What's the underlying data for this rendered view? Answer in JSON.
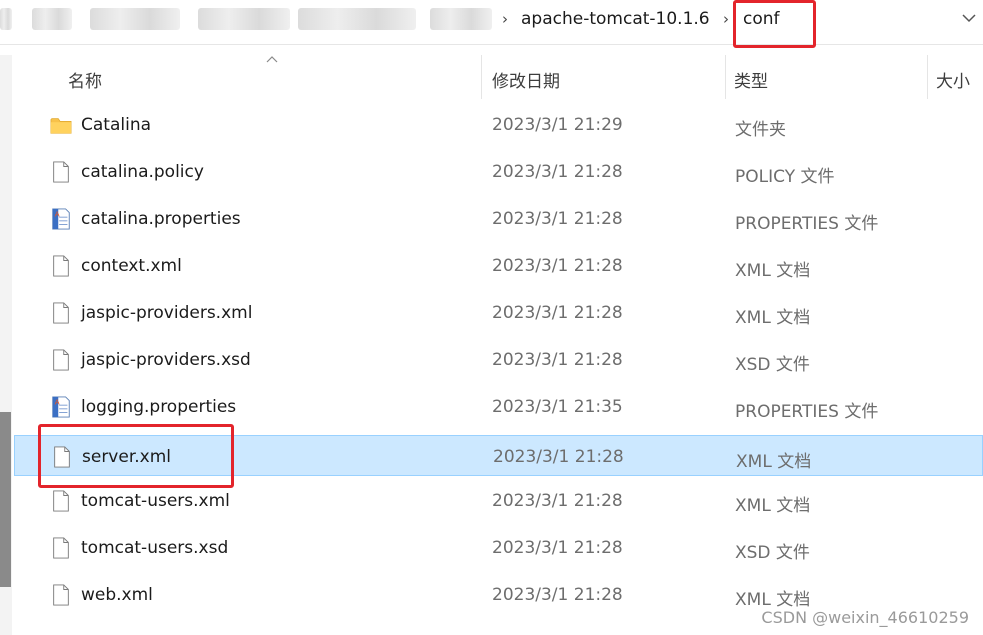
{
  "breadcrumb": {
    "separator": "›",
    "items": [
      "apache-tomcat-10.1.6",
      "conf"
    ]
  },
  "columns": {
    "name": "名称",
    "date": "修改日期",
    "type": "类型",
    "size": "大小"
  },
  "files": [
    {
      "name": "Catalina",
      "date": "2023/3/1 21:29",
      "type": "文件夹",
      "icon": "folder-icon"
    },
    {
      "name": "catalina.policy",
      "date": "2023/3/1 21:28",
      "type": "POLICY 文件",
      "icon": "file-icon"
    },
    {
      "name": "catalina.properties",
      "date": "2023/3/1 21:28",
      "type": "PROPERTIES 文件",
      "icon": "properties-file-icon"
    },
    {
      "name": "context.xml",
      "date": "2023/3/1 21:28",
      "type": "XML 文档",
      "icon": "file-icon"
    },
    {
      "name": "jaspic-providers.xml",
      "date": "2023/3/1 21:28",
      "type": "XML 文档",
      "icon": "file-icon"
    },
    {
      "name": "jaspic-providers.xsd",
      "date": "2023/3/1 21:28",
      "type": "XSD 文件",
      "icon": "file-icon"
    },
    {
      "name": "logging.properties",
      "date": "2023/3/1 21:35",
      "type": "PROPERTIES 文件",
      "icon": "properties-file-icon"
    },
    {
      "name": "server.xml",
      "date": "2023/3/1 21:28",
      "type": "XML 文档",
      "icon": "file-icon",
      "selected": true
    },
    {
      "name": "tomcat-users.xml",
      "date": "2023/3/1 21:28",
      "type": "XML 文档",
      "icon": "file-icon"
    },
    {
      "name": "tomcat-users.xsd",
      "date": "2023/3/1 21:28",
      "type": "XSD 文件",
      "icon": "file-icon"
    },
    {
      "name": "web.xml",
      "date": "2023/3/1 21:28",
      "type": "XML 文档",
      "icon": "file-icon"
    }
  ],
  "watermark": "CSDN @weixin_46610259",
  "colors": {
    "selection": "#cce8ff",
    "selection_border": "#99d1ff",
    "highlight": "#e3242b",
    "folder": "#f8c24a"
  }
}
